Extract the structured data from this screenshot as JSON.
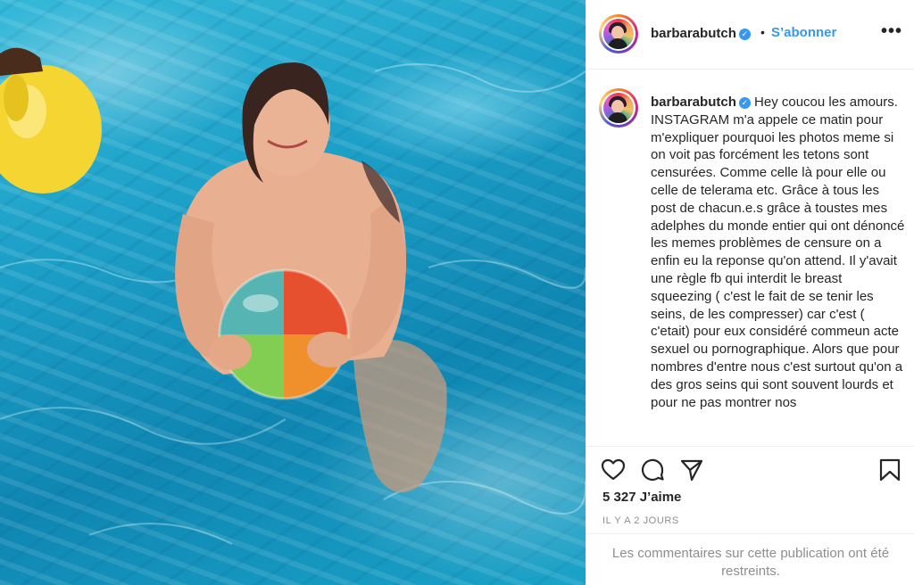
{
  "post": {
    "photo_alt": "Photo",
    "colors": {
      "pool": "#1c9fc7",
      "float": "#f5d531"
    }
  },
  "header": {
    "username": "barbarabutch",
    "verified_glyph": "✓",
    "separator": "•",
    "follow_label": "S’abonner",
    "more_label": "•••",
    "more_icon": "more-options-icon"
  },
  "caption": {
    "username": "barbarabutch",
    "verified_glyph": "✓",
    "text": "Hey coucou les amours. INSTAGRAM m'a appele ce matin pour m'expliquer pourquoi les photos meme si on voit pas forcément les tetons sont censurées. Comme celle là pour elle ou celle de telerama etc. Grâce à tous les post de chacun.e.s grâce à toustes mes adelphes du monde entier qui ont dénoncé les memes problèmes de censure on a enfin eu la reponse qu'on attend. Il y'avait une règle fb qui interdit le breast squeezing ( c'est le fait de se tenir les seins, de les compresser) car c'est ( c'etait) pour eux considéré commeun acte sexuel ou pornographique. Alors que pour nombres d'entre nous c'est surtout qu'on a des gros seins qui sont souvent lourds et pour ne pas montrer nos"
  },
  "actions": {
    "icons": [
      "heart-icon",
      "comment-icon",
      "share-icon",
      "bookmark-icon"
    ],
    "likes_text": "5 327 J’aime",
    "time_text": "IL Y A 2 JOURS"
  },
  "comments": {
    "restricted_text": "Les commentaires sur cette publication ont été restreints."
  },
  "colors": {
    "accent": "#3897f0",
    "text": "#262626",
    "muted": "#8e8e8e",
    "border": "#efefef"
  }
}
